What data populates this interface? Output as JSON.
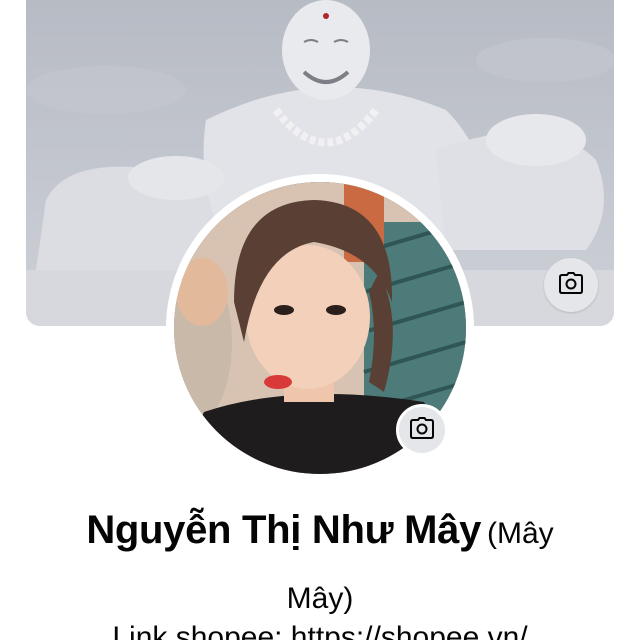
{
  "profile": {
    "name": "Nguyễn Thị Như Mây",
    "alternate_name_line1": "(Mây",
    "alternate_name_line2": "Mây)",
    "bio_text": "Link shopee: https://shopee.vn/"
  },
  "icons": {
    "cover_camera": "camera-icon",
    "avatar_camera": "camera-icon"
  },
  "colors": {
    "background": "#ffffff",
    "camera_button": "#e4e6ea",
    "text": "#050505"
  }
}
